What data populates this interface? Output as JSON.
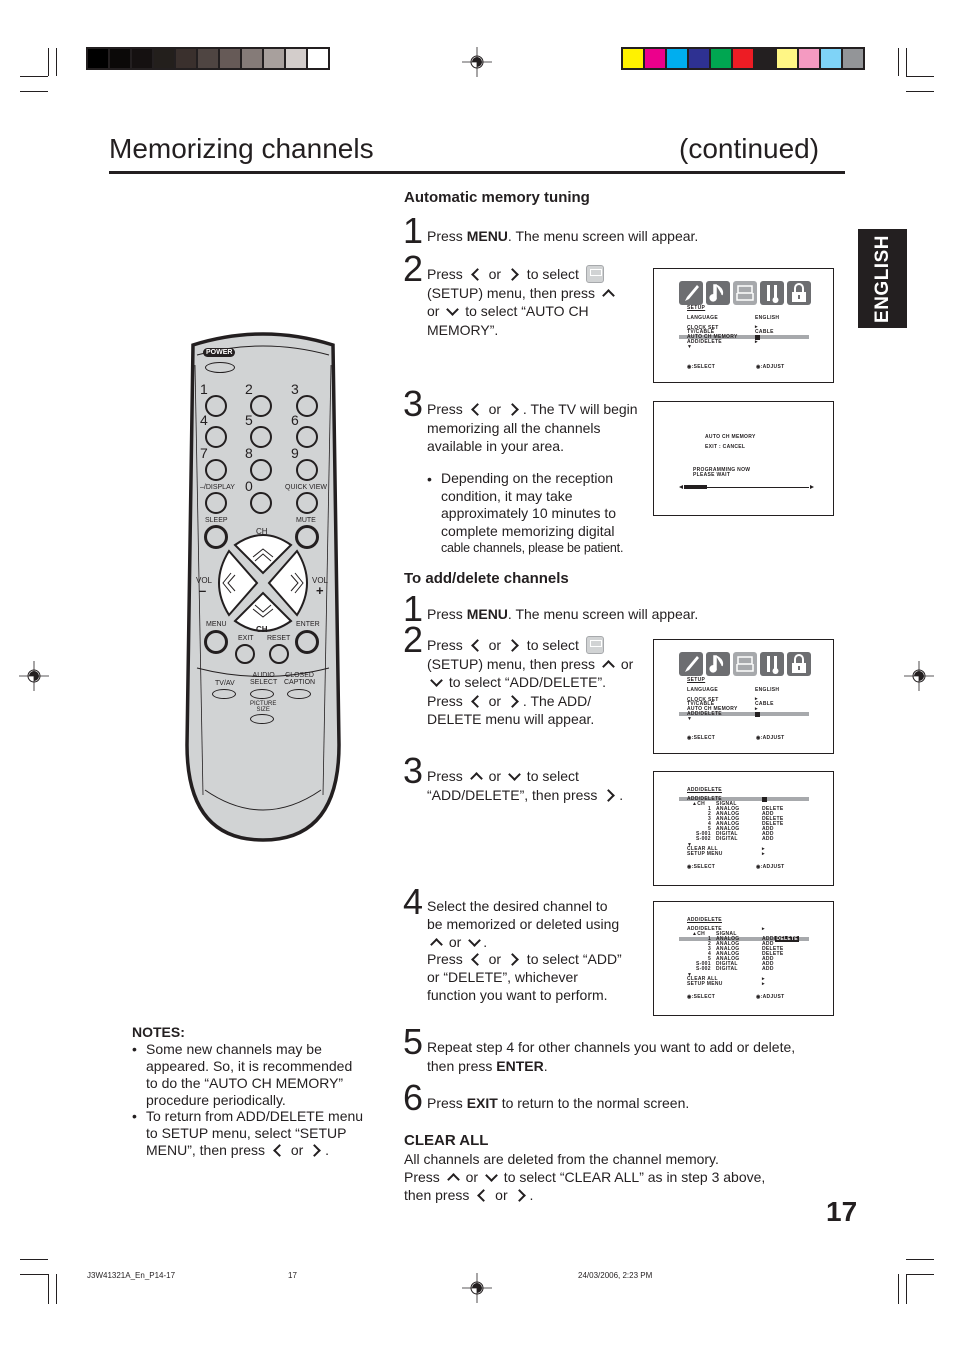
{
  "print_marks": {
    "gray_swatches": [
      "#000000",
      "#0b0908",
      "#151111",
      "#231f1c",
      "#3a302d",
      "#4f4542",
      "#665a57",
      "#857b78",
      "#a8a09d",
      "#d3cdcb",
      "#ffffff"
    ],
    "color_swatches": [
      "#fff200",
      "#ec008c",
      "#00aeef",
      "#2e3192",
      "#00a651",
      "#ed1c24",
      "#231f20",
      "#fff685",
      "#f49ac1",
      "#7fd3f7",
      "#939598"
    ]
  },
  "header": {
    "title": "Memorizing channels",
    "continued": "(continued)",
    "language_tab": "ENGLISH"
  },
  "auto_memory": {
    "heading": "Automatic memory tuning",
    "steps": [
      {
        "num": "1",
        "pre": "Press ",
        "bold": "MENU",
        "post": ". The menu screen will appear."
      },
      {
        "num": "2",
        "l1a": "Press ",
        "l1b": " or ",
        "l1c": " to select ",
        "l2a": "(SETUP) menu, then press ",
        "l3a": "or ",
        "l3b": " to select “AUTO CH",
        "l4": "MEMORY”."
      },
      {
        "num": "3",
        "l1a": "Press ",
        "l1b": " or ",
        "l1c": ". The TV will begin",
        "l2": "memorizing all the channels",
        "l3": "available in your area.",
        "bullet": "•",
        "b1": "Depending on the reception",
        "b2": "condition, it may take",
        "b3": "approximately 10 minutes to",
        "b4": "complete memorizing digital",
        "b5": "cable channels, please be patient."
      }
    ]
  },
  "add_delete": {
    "heading": "To add/delete channels",
    "steps": [
      {
        "num": "1",
        "pre": "Press ",
        "bold": "MENU",
        "post": ". The menu screen will appear."
      },
      {
        "num": "2",
        "l1a": "Press ",
        "l1b": " or ",
        "l1c": " to select ",
        "l2a": "(SETUP) menu, then press ",
        "l2b": " or",
        "l3": " to select “ADD/DELETE”.",
        "l4a": "Press ",
        "l4b": " or ",
        "l4c": ". The ADD/",
        "l5": "DELETE menu will appear."
      },
      {
        "num": "3",
        "l1a": "Press ",
        "l1b": " or ",
        "l1c": " to select",
        "l2a": "“ADD/DELETE”, then press ",
        "l2b": "."
      },
      {
        "num": "4",
        "l1": "Select the desired channel to",
        "l2": "be memorized or deleted using",
        "l3a": " or ",
        "l3b": ".",
        "l4a": "Press ",
        "l4b": " or ",
        "l4c": " to select “ADD”",
        "l5": "or “DELETE”, whichever",
        "l6": "function you want to perform."
      },
      {
        "num": "5",
        "l1": "Repeat step 4 for other channels you want to add or delete,",
        "l2a": "then press ",
        "l2b": "ENTER",
        "l2c": "."
      },
      {
        "num": "6",
        "pre": "Press ",
        "bold": "EXIT",
        "post": " to return to the normal screen."
      }
    ]
  },
  "screens": {
    "setup": {
      "title": "SETUP",
      "rows": [
        {
          "label": "LANGUAGE",
          "value": "ENGLISH"
        },
        {
          "label": "CLOCK SET",
          "value": "▸"
        },
        {
          "label": "TV/CABLE",
          "value": "CABLE"
        },
        {
          "label": "AUTO CH MEMORY",
          "value": ""
        },
        {
          "label": "ADD/DELETE",
          "value": "▸"
        }
      ],
      "more": "▼",
      "select": ":SELECT",
      "adjust": ":ADJUST"
    },
    "progress": {
      "line1": "AUTO CH MEMORY",
      "line2": "EXIT : CANCEL",
      "line3": "PROGRAMMING NOW",
      "line4": "PLEASE WAIT",
      "progress_fraction": 0.18
    },
    "add_delete": {
      "title": "ADD/DELETE",
      "top_row": "ADD/DELETE",
      "col_ch": "▲CH",
      "col_signal": "SIGNAL",
      "channels": [
        {
          "ch": "1",
          "signal": "ANALOG",
          "status": "DELETE"
        },
        {
          "ch": "2",
          "signal": "ANALOG",
          "status": "ADD"
        },
        {
          "ch": "3",
          "signal": "ANALOG",
          "status": "DELETE"
        },
        {
          "ch": "4",
          "signal": "ANALOG",
          "status": "DELETE"
        },
        {
          "ch": "5",
          "signal": "ANALOG",
          "status": "ADD"
        },
        {
          "ch": "S-001",
          "signal": "DIGITAL",
          "status": "ADD"
        },
        {
          "ch": "S-002",
          "signal": "DIGITAL",
          "status": "ADD"
        }
      ],
      "more": "▼",
      "clear_all": "CLEAR ALL",
      "setup_menu": "SETUP MENU",
      "arrow": "▸",
      "select": ":SELECT",
      "adjust": ":ADJUST"
    },
    "add_delete_2": {
      "row1_status_a": "ADD/",
      "row1_status_b": "DELETE",
      "channels": [
        {
          "ch": "1",
          "signal": "ANALOG",
          "status": ""
        },
        {
          "ch": "2",
          "signal": "ANALOG",
          "status": "ADD"
        },
        {
          "ch": "3",
          "signal": "ANALOG",
          "status": "DELETE"
        },
        {
          "ch": "4",
          "signal": "ANALOG",
          "status": "DELETE"
        },
        {
          "ch": "5",
          "signal": "ANALOG",
          "status": "ADD"
        },
        {
          "ch": "S-001",
          "signal": "DIGITAL",
          "status": "ADD"
        },
        {
          "ch": "S-002",
          "signal": "DIGITAL",
          "status": "ADD"
        }
      ]
    }
  },
  "remote": {
    "power": "POWER",
    "digits": [
      "1",
      "2",
      "3",
      "4",
      "5",
      "6",
      "7",
      "8",
      "9",
      "0"
    ],
    "display": "–/DISPLAY",
    "quick_view": "QUICK VIEW",
    "sleep": "SLEEP",
    "mute": "MUTE",
    "ch_up": "CH",
    "ch_down": "CH",
    "vol": "VOL",
    "vol_minus": "–",
    "vol_plus": "+",
    "menu": "MENU",
    "enter": "ENTER",
    "exit": "EXIT",
    "reset": "RESET",
    "tvav": "TV/AV",
    "audio1": "AUDIO",
    "audio2": "SELECT",
    "cc1": "CLOSED",
    "cc2": "CAPTION",
    "pic1": "PICTURE",
    "pic2": "SIZE"
  },
  "notes": {
    "heading": "NOTES:",
    "bullet": "•",
    "n1": [
      "Some new channels may be",
      "appeared. So, it is recommended",
      "to do the “AUTO CH MEMORY”",
      "procedure periodically."
    ],
    "n2a": [
      "To return from ADD/DELETE menu",
      "to SETUP menu, select “SETUP"
    ],
    "n2b_pre": "MENU”, then press ",
    "n2b_or": " or ",
    "n2b_post": "."
  },
  "clear_all": {
    "heading": "CLEAR ALL",
    "l1": "All channels are deleted from the channel memory.",
    "l2a": "Press ",
    "l2b": " or ",
    "l2c": " to select “CLEAR ALL” as in step 3 above,",
    "l3a": "then press ",
    "l3b": " or ",
    "l3c": "."
  },
  "page_number": "17",
  "footer": {
    "file": "J3W41321A_En_P14-17",
    "page": "17",
    "date": "24/03/2006, 2:23 PM"
  }
}
